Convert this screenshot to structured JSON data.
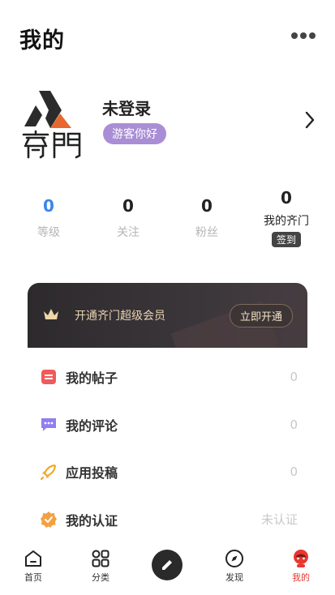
{
  "header": {
    "title": "我的"
  },
  "profile": {
    "username": "未登录",
    "guest_badge": "游客你好"
  },
  "stats": [
    {
      "value": "0",
      "label": "等级"
    },
    {
      "value": "0",
      "label": "关注"
    },
    {
      "value": "0",
      "label": "粉丝"
    },
    {
      "value": "0",
      "label": "我的齐门",
      "action": "签到"
    }
  ],
  "vip": {
    "text": "开通齐门超级会员",
    "button": "立即开通"
  },
  "menu": [
    {
      "label": "我的帖子",
      "value": "0",
      "icon": "post-icon"
    },
    {
      "label": "我的评论",
      "value": "0",
      "icon": "comment-icon"
    },
    {
      "label": "应用投稿",
      "value": "0",
      "icon": "rocket-icon"
    },
    {
      "label": "我的认证",
      "value": "未认证",
      "icon": "verified-icon"
    }
  ],
  "tabbar": [
    {
      "label": "首页",
      "icon": "home-icon"
    },
    {
      "label": "分类",
      "icon": "grid-icon"
    },
    {
      "label": "发现",
      "icon": "compass-icon"
    },
    {
      "label": "我的",
      "icon": "profile-icon"
    }
  ],
  "colors": {
    "accent": "#e8372f",
    "level_blue": "#3b86e8",
    "badge_purple": "#a98ed6",
    "vip_gold": "#e8d3b2"
  }
}
